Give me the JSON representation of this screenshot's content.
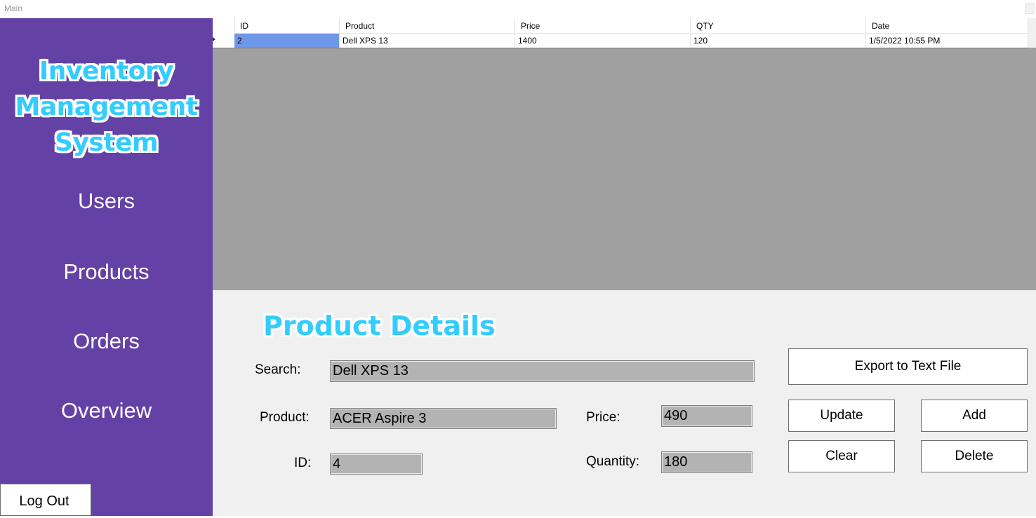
{
  "window": {
    "title": "Main"
  },
  "sidebar": {
    "logo_lines": [
      "Inventory",
      "Management",
      "System"
    ],
    "items": [
      {
        "label": "Users"
      },
      {
        "label": "Products"
      },
      {
        "label": "Orders"
      },
      {
        "label": "Overview"
      }
    ],
    "logout_label": "Log Out"
  },
  "grid": {
    "columns": [
      "ID",
      "Product",
      "Price",
      "QTY",
      "Date"
    ],
    "rows": [
      [
        "2",
        "Dell XPS 13",
        "1400",
        "120",
        "1/5/2022 10:55 PM"
      ]
    ]
  },
  "details": {
    "title": "Product Details",
    "search": {
      "label": "Search:",
      "value": "Dell XPS 13"
    },
    "product": {
      "label": "Product:",
      "value": "ACER Aspire 3"
    },
    "id": {
      "label": "ID:",
      "value": "4"
    },
    "price": {
      "label": "Price:",
      "value": "490"
    },
    "quantity": {
      "label": "Quantity:",
      "value": "180"
    },
    "buttons": {
      "export": "Export to Text File",
      "update": "Update",
      "add": "Add",
      "clear": "Clear",
      "delete": "Delete"
    }
  },
  "colors": {
    "sidebar": "#6441a5",
    "accent": "#33ccff",
    "selection": "#6f98e8",
    "grid_background": "#a0a0a0"
  }
}
